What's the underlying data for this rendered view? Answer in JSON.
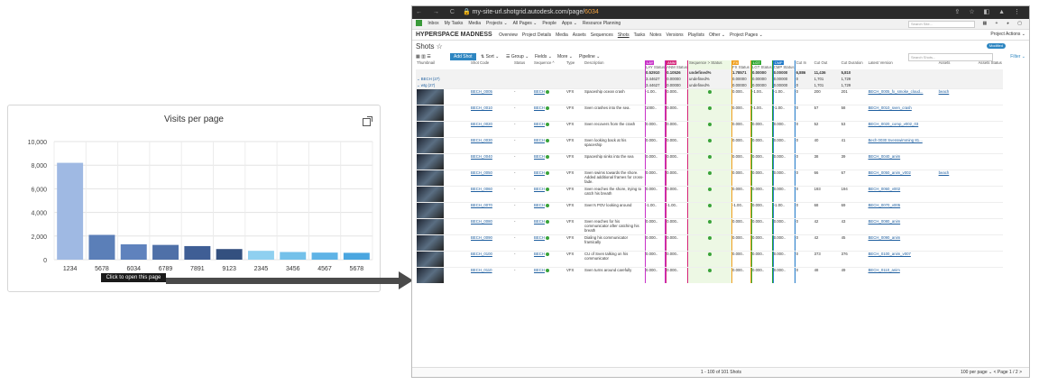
{
  "chart_data": {
    "type": "bar",
    "title": "Visits per page",
    "categories": [
      "1234",
      "5678",
      "6034",
      "6789",
      "7891",
      "9123",
      "2345",
      "3456",
      "4567",
      "5678"
    ],
    "values": [
      8200,
      2100,
      1300,
      1250,
      1150,
      900,
      750,
      650,
      600,
      580
    ],
    "colors": [
      "#9fb9e3",
      "#5b7fb8",
      "#5f82bd",
      "#4f70a8",
      "#3f5e95",
      "#33507f",
      "#8fd0f0",
      "#74c1ea",
      "#5fb3e6",
      "#4aa6e0"
    ],
    "ylim": [
      0,
      10000
    ],
    "yticks": [
      "10,000",
      "8,000",
      "6,000",
      "4,000",
      "2,000",
      "0"
    ],
    "grid": true
  },
  "tooltip": "Click to open this page",
  "browser": {
    "nav_icons": "← → C",
    "url_prefix": "my-site-url.shotgrid.autodesk.com/page/",
    "url_num": "6034",
    "right_icons": "⇪ ☆ ◧ ▲ ⋮"
  },
  "topnav": {
    "items": [
      "Inbox",
      "My Tasks",
      "Media",
      "Projects ⌄",
      "All Pages ⌄",
      "People",
      "Apps ⌄",
      "Resource Planning"
    ],
    "search": "Search Site..."
  },
  "project": {
    "name": "HYPERSPACE MADNESS",
    "items": [
      "Overview",
      "Project Details",
      "Media",
      "Assets",
      "Sequences",
      "Shots",
      "Tasks",
      "Notes",
      "Versions",
      "Playlists",
      "Other ⌄",
      "Project Pages ⌄"
    ],
    "actions": "Project Actions ⌄"
  },
  "page": {
    "title": "Shots ☆",
    "badge": "Modified"
  },
  "toolbar": {
    "add_shot": "Add Shot",
    "sort": "⇅ Sort ⌄",
    "group": "☰ Group ⌄",
    "fields": "Fields ⌄",
    "more": "More ⌄",
    "pipeline": "Pipeline ⌄",
    "search": "Search Shots...",
    "filter": "Filter ⌄"
  },
  "headers": [
    "Thumbnail",
    "Shot Code",
    "Status",
    "Sequence ^",
    "Type",
    "Description",
    "LAY Status",
    "ANM Status",
    "Sequence > Status",
    "FX Status",
    "LGT Status",
    "CMP Status",
    "Cut In",
    "Cut Out",
    "Cut Duration",
    "Latest Version",
    "Assets",
    "Assets Status"
  ],
  "tags": {
    "lay": "LAY",
    "anm": "ANM",
    "fx": "FX",
    "lgt": "LGT",
    "cmp": "CMP"
  },
  "sum_row": [
    "0.52910",
    "0.10526",
    "undefined%",
    "1.78571",
    "0.00000",
    "0.00000",
    "6,886",
    "11,436",
    "5,810"
  ],
  "groups": [
    {
      "label": "⌄ BECH (27)",
      "vals": [
        "3.44627",
        "0.00000",
        "undefined%",
        "0.00000",
        "0.00000",
        "0.00000",
        "0",
        "1,701",
        "1,729"
      ]
    },
    {
      "label": "⌄ wtg (27)",
      "vals": [
        "3.44627",
        "0.00000",
        "undefined%",
        "0.00000",
        "0.00000",
        "0.00000",
        "0",
        "1,701",
        "1,729"
      ]
    }
  ],
  "rows": [
    {
      "code": "BECH_0005",
      "desc": "Spaceship ocean crash",
      "lay": "-1.00..",
      "anm": "0.000..",
      "fx": "0.000..",
      "lgt": "-1.00..",
      "cmp": "-1.00..",
      "cin": "0",
      "cout": "200",
      "dur": "201",
      "ver": "BECH_0005_fx_smoke_cloud...",
      "asset": "beach"
    },
    {
      "code": "BECH_0010",
      "desc": "Sven crashes into the sea.",
      "lay": "1000..",
      "anm": "0.000..",
      "fx": "0.000..",
      "lgt": "-1.00..",
      "cmp": "-1.00..",
      "cin": "0",
      "cout": "57",
      "dur": "58",
      "ver": "BECH_0010_sven_crash",
      "asset": ""
    },
    {
      "code": "BECH_0020",
      "desc": "Sven recovers from the crash",
      "lay": "0.000..",
      "anm": "0.000..",
      "fx": "0.000..",
      "lgt": "0.000..",
      "cmp": "0.000..",
      "cin": "0",
      "cout": "52",
      "dur": "53",
      "ver": "BECH_0020_comp_v002_03",
      "asset": ""
    },
    {
      "code": "BECH_0030",
      "desc": "Sven looking back at his spaceship",
      "lay": "0.000..",
      "anm": "0.000..",
      "fx": "0.000..",
      "lgt": "0.000..",
      "cmp": "0.000..",
      "cin": "0",
      "cout": "40",
      "dur": "41",
      "ver": "Bech 0030 Svenswimming 81...",
      "asset": ""
    },
    {
      "code": "BECH_0040",
      "desc": "Spaceship sinks into the sea",
      "lay": "0.000..",
      "anm": "0.000..",
      "fx": "0.000..",
      "lgt": "0.000..",
      "cmp": "0.000..",
      "cin": "0",
      "cout": "38",
      "dur": "39",
      "ver": "BECH_0040_anim",
      "asset": ""
    },
    {
      "code": "BECH_0050",
      "desc": "Sven swims towards the shore. Added additional frames for cross-fade.",
      "lay": "0.000..",
      "anm": "0.000..",
      "fx": "0.000..",
      "lgt": "0.000..",
      "cmp": "0.000..",
      "cin": "0",
      "cout": "66",
      "dur": "67",
      "ver": "BECH_0050_anim_v002",
      "asset": "beach"
    },
    {
      "code": "BECH_0060",
      "desc": "Sven reaches the shore, trying to catch his breath",
      "lay": "0.000..",
      "anm": "0.000..",
      "fx": "0.000..",
      "lgt": "0.000..",
      "cmp": "0.000..",
      "cin": "0",
      "cout": "193",
      "dur": "194",
      "ver": "BECH_0060_v002",
      "asset": ""
    },
    {
      "code": "BECH_0070",
      "desc": "Sven's POV looking around",
      "lay": "-1.00..",
      "anm": "-1.00..",
      "fx": "-1.00..",
      "lgt": "0.000..",
      "cmp": "-1.00..",
      "cin": "0",
      "cout": "68",
      "dur": "69",
      "ver": "BECH_0070_v005",
      "asset": ""
    },
    {
      "code": "BECH_0080",
      "desc": "Sven reaches for his communicator after catching his breath",
      "lay": "0.000..",
      "anm": "0.000..",
      "fx": "0.000..",
      "lgt": "0.000..",
      "cmp": "0.000..",
      "cin": "0",
      "cout": "42",
      "dur": "43",
      "ver": "BECH_0080_anim",
      "asset": ""
    },
    {
      "code": "BECH_0090",
      "desc": "Dialing his communicator frantically",
      "lay": "0.000..",
      "anm": "0.000..",
      "fx": "0.000..",
      "lgt": "0.000..",
      "cmp": "0.000..",
      "cin": "0",
      "cout": "42",
      "dur": "45",
      "ver": "BECH_0090_anim",
      "asset": ""
    },
    {
      "code": "BECH_0100",
      "desc": "CU of Sven talking on his communicator",
      "lay": "0.000..",
      "anm": "0.000..",
      "fx": "0.000..",
      "lgt": "0.000..",
      "cmp": "0.000..",
      "cin": "0",
      "cout": "373",
      "dur": "376",
      "ver": "BECH_0100_anim_v007",
      "asset": ""
    },
    {
      "code": "BECH_0110",
      "desc": "Sven turns around carefully",
      "lay": "0.000..",
      "anm": "0.000..",
      "fx": "0.000..",
      "lgt": "0.000..",
      "cmp": "0.000..",
      "cin": "0",
      "cout": "48",
      "dur": "49",
      "ver": "BECH_0110_anim",
      "asset": ""
    }
  ],
  "common": {
    "status": "-",
    "seq": "BECH",
    "type": "VFX"
  },
  "footer": {
    "count": "1 - 100 of 101 Shots",
    "per_page": "100 per page ⌄",
    "page": "< Page 1 / 2 >"
  }
}
